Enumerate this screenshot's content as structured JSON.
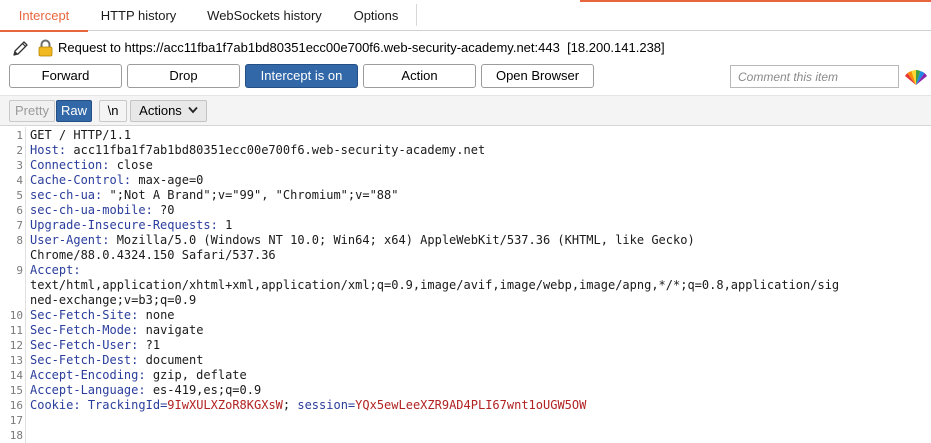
{
  "tabs": [
    {
      "label": "Intercept",
      "active": true
    },
    {
      "label": "HTTP history",
      "active": false
    },
    {
      "label": "WebSockets history",
      "active": false
    },
    {
      "label": "Options",
      "active": false
    }
  ],
  "request_info": {
    "prefix": "Request to ",
    "url": "https://acc11fba1f7ab1bd80351ecc00e700f6.web-security-academy.net:443",
    "ip": "[18.200.141.238]"
  },
  "toolbar": {
    "forward": "Forward",
    "drop": "Drop",
    "intercept": "Intercept is on",
    "action": "Action",
    "open_browser": "Open Browser",
    "comment_placeholder": "Comment this item"
  },
  "editor_toolbar": {
    "pretty": "Pretty",
    "raw": "Raw",
    "newline": "\\n",
    "actions": "Actions"
  },
  "colors": {
    "accent": "#e8663d",
    "primary_button": "#3268a8",
    "header_name": "#2a3d9c",
    "cookie_value": "#b22222"
  },
  "request_lines": [
    {
      "num": "1",
      "text": "GET / HTTP/1.1"
    },
    {
      "num": "2",
      "name": "Host",
      "value": " acc11fba1f7ab1bd80351ecc00e700f6.web-security-academy.net"
    },
    {
      "num": "3",
      "name": "Connection",
      "value": " close"
    },
    {
      "num": "4",
      "name": "Cache-Control",
      "value": " max-age=0"
    },
    {
      "num": "5",
      "name": "sec-ch-ua",
      "value": " \";Not A Brand\";v=\"99\", \"Chromium\";v=\"88\""
    },
    {
      "num": "6",
      "name": "sec-ch-ua-mobile",
      "value": " ?0"
    },
    {
      "num": "7",
      "name": "Upgrade-Insecure-Requests",
      "value": " 1"
    },
    {
      "num": "8",
      "name": "User-Agent",
      "value": " Mozilla/5.0 (Windows NT 10.0; Win64; x64) AppleWebKit/537.36 (KHTML, like Gecko)"
    },
    {
      "num": "",
      "text": "Chrome/88.0.4324.150 Safari/537.36"
    },
    {
      "num": "9",
      "name": "Accept",
      "value": ""
    },
    {
      "num": "",
      "text": "text/html,application/xhtml+xml,application/xml;q=0.9,image/avif,image/webp,image/apng,*/*;q=0.8,application/sig"
    },
    {
      "num": "",
      "text": "ned-exchange;v=b3;q=0.9"
    },
    {
      "num": "10",
      "name": "Sec-Fetch-Site",
      "value": " none"
    },
    {
      "num": "11",
      "name": "Sec-Fetch-Mode",
      "value": " navigate"
    },
    {
      "num": "12",
      "name": "Sec-Fetch-User",
      "value": " ?1"
    },
    {
      "num": "13",
      "name": "Sec-Fetch-Dest",
      "value": " document"
    },
    {
      "num": "14",
      "name": "Accept-Encoding",
      "value": " gzip, deflate"
    },
    {
      "num": "15",
      "name": "Accept-Language",
      "value": " es-419,es;q=0.9"
    },
    {
      "num": "16",
      "cookie": true,
      "name": "Cookie",
      "c1_name": "TrackingId",
      "c1_value": "9IwXULXZoR8KGXsW",
      "c2_name": "session",
      "c2_value": "YQx5ewLeeXZR9AD4PLI67wnt1oUGW5OW"
    },
    {
      "num": "17",
      "text": ""
    },
    {
      "num": "18",
      "text": ""
    }
  ]
}
